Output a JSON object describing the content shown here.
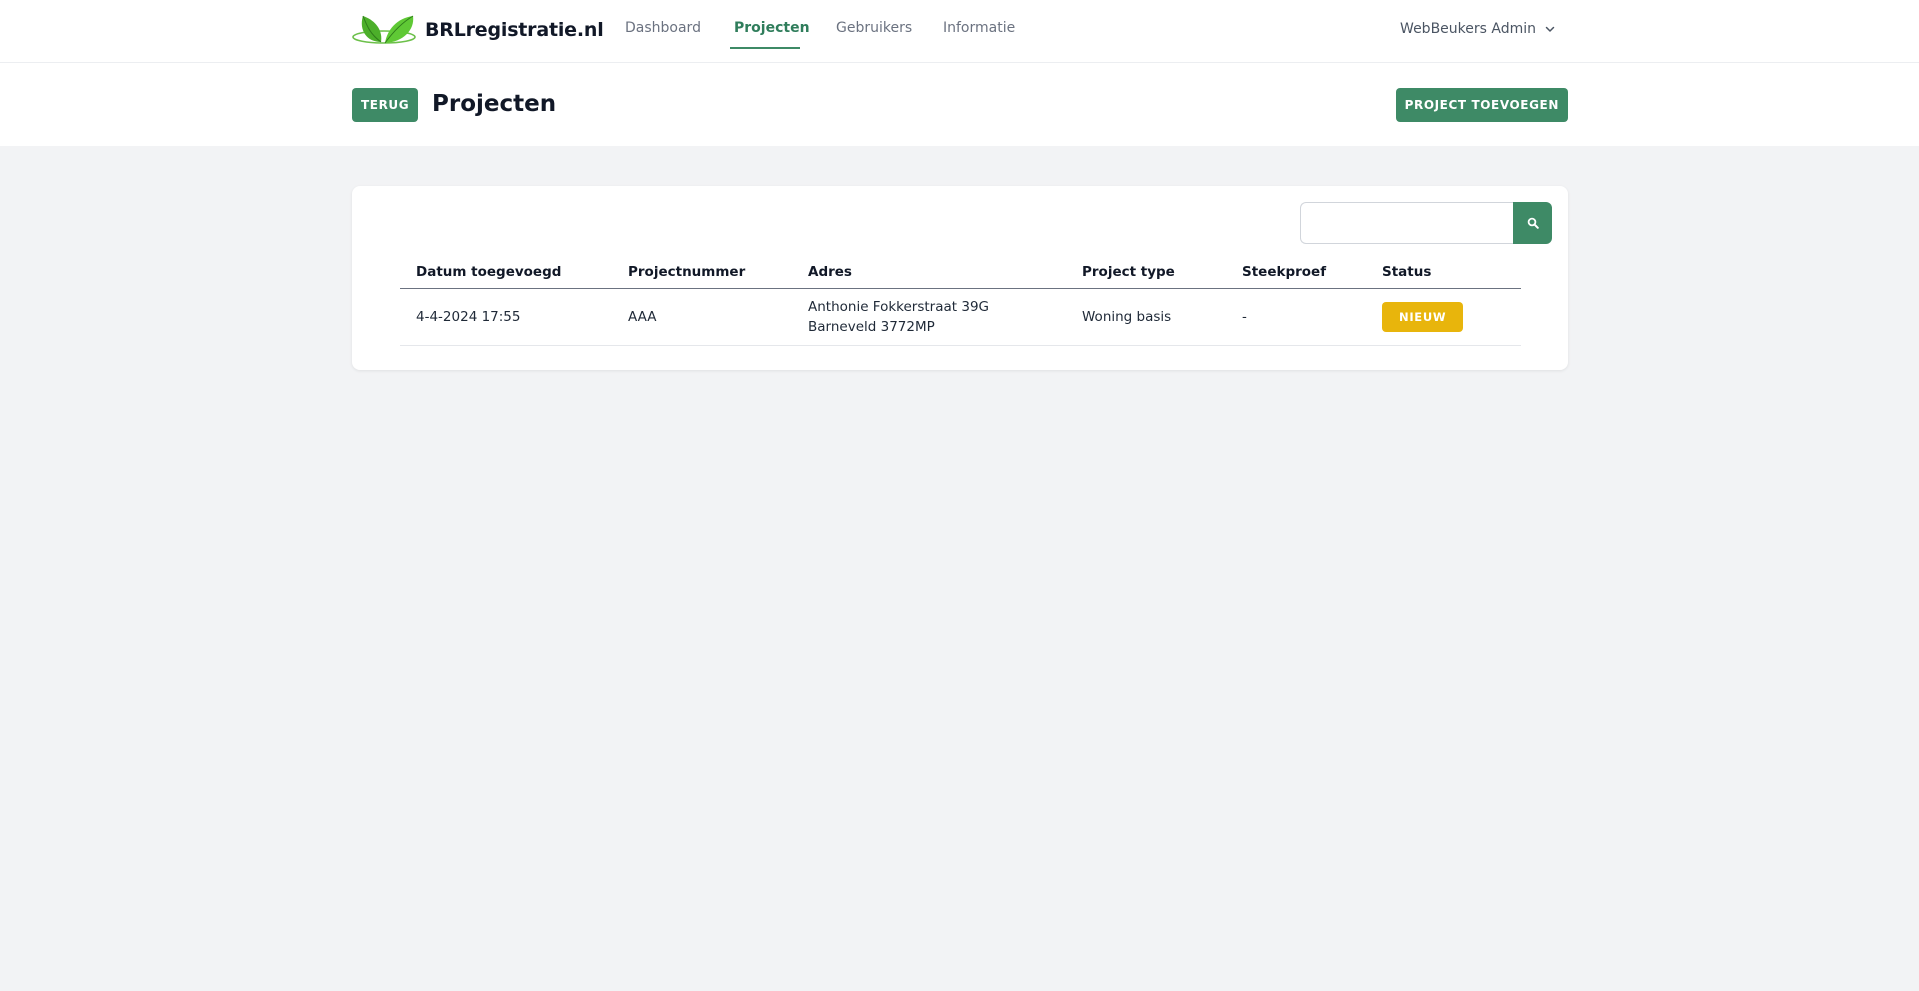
{
  "nav": {
    "brand": "BRLregistratie.nl",
    "links": [
      "Dashboard",
      "Projecten",
      "Gebruikers",
      "Informatie"
    ],
    "active_link": "Projecten",
    "user": "WebBeukers Admin"
  },
  "header": {
    "back_label": "TERUG",
    "title": "Projecten",
    "add_label": "PROJECT TOEVOEGEN"
  },
  "search": {
    "value": "",
    "icon": "search-icon"
  },
  "table": {
    "columns": [
      "Datum toegevoegd",
      "Projectnummer",
      "Adres",
      "Project type",
      "Steekproef",
      "Status"
    ],
    "rows": [
      {
        "date": "4-4-2024 17:55",
        "number": "AAA",
        "address_line1": "Anthonie Fokkerstraat 39G",
        "address_line2": "Barneveld 3772MP",
        "type": "Woning basis",
        "sample": "-",
        "status": "NIEUW"
      }
    ]
  },
  "colors": {
    "primary": "#3e8a66",
    "status_new": "#e8b50c",
    "background": "#f2f3f5"
  }
}
